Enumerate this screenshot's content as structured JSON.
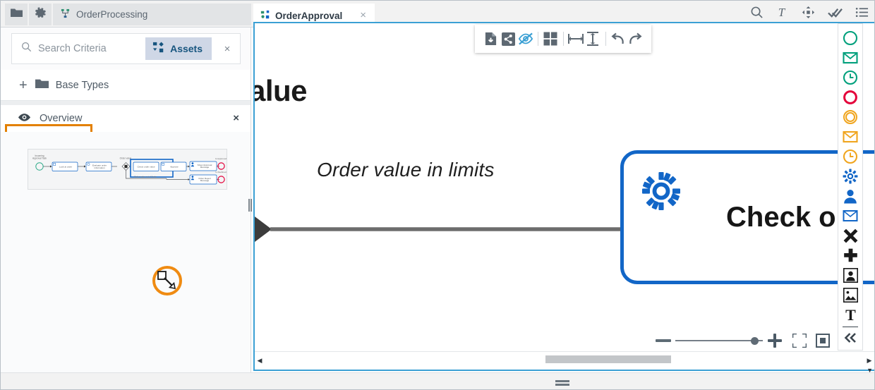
{
  "window": {
    "title": "OrderApproval"
  },
  "topbar": {
    "buttons": [
      {
        "name": "folder-icon",
        "label": ""
      },
      {
        "name": "gear-icon",
        "label": ""
      }
    ],
    "process_tab": {
      "label": "OrderProcessing",
      "icon": "process-diagram-icon"
    },
    "active_tab": {
      "label": "OrderApproval",
      "icon": "bpmn-diagram-icon",
      "close_label": "×"
    },
    "right_icons": [
      {
        "name": "search-icon"
      },
      {
        "name": "text-format-icon"
      },
      {
        "name": "move-icon"
      },
      {
        "name": "double-check-icon"
      },
      {
        "name": "list-icon"
      }
    ]
  },
  "sidebar": {
    "search": {
      "placeholder": "Search Criteria",
      "icon": "search-icon",
      "chip_label": "Assets",
      "chip_icon": "assets-icon",
      "clear_label": "×"
    },
    "base_types": {
      "add_label": "+",
      "label": "Base Types",
      "icon": "folder-icon"
    },
    "overview": {
      "label": "Overview",
      "icon": "eye-icon",
      "close_label": "×",
      "highlighted": true,
      "highlight_color": "#e38000"
    },
    "thumbnail": {
      "name": "overview-thumbnail",
      "nodes": [
        {
          "label": "Incoming\\nApproval Task",
          "type": "start-event"
        },
        {
          "label": "Look at order",
          "type": "task"
        },
        {
          "label": "Evaluate order\\ninformation",
          "type": "task"
        },
        {
          "label": "Order value",
          "type": "gateway"
        },
        {
          "label": "Check order value",
          "type": "task"
        },
        {
          "label": "Approve",
          "type": "task"
        },
        {
          "label": "Order Approved\\nMessage",
          "type": "task"
        },
        {
          "label": "Order Reject\\nMessage",
          "type": "task"
        },
        {
          "label": "Is Approved",
          "type": "end-event"
        },
        {
          "label": "Is Declined",
          "type": "end-event"
        }
      ],
      "viewport_box_color": "#1266c7",
      "cursor_highlight_color": "#ef8b12"
    }
  },
  "editor": {
    "border_color": "#3ba0d4",
    "float_toolbar": [
      {
        "name": "export-file-icon"
      },
      {
        "name": "share-icon"
      },
      {
        "name": "hide-eye-icon"
      },
      {
        "name": "grid-layout-icon"
      },
      {
        "name": "horizontal-spacing-icon"
      },
      {
        "name": "vertical-spacing-icon"
      },
      {
        "name": "undo-icon"
      },
      {
        "name": "redo-icon"
      }
    ],
    "canvas": {
      "clipped_title": "alue",
      "flow_label": "Order value in limits",
      "task": {
        "label": "Check ou",
        "icon": "gear-icon",
        "border_color": "#1266c7"
      }
    },
    "zoom_controls": {
      "zoom_out_label": "−",
      "zoom_in_label": "+",
      "slider_value": 92,
      "fit_icon": "fit-to-screen-icon",
      "actual_size_icon": "actual-size-icon"
    },
    "scrollbar": {
      "left_arrow": "◀",
      "right_arrow": "▶"
    }
  },
  "palette": {
    "items": [
      {
        "name": "start-event-none",
        "color": "#00a07c",
        "shape": "circle"
      },
      {
        "name": "start-event-message",
        "color": "#00a07c",
        "shape": "envelope"
      },
      {
        "name": "start-event-timer",
        "color": "#00a07c",
        "shape": "clock"
      },
      {
        "name": "end-event-none",
        "color": "#e4003a",
        "shape": "circle-thick"
      },
      {
        "name": "intermediate-event-none",
        "color": "#f0a51e",
        "shape": "double-circle"
      },
      {
        "name": "intermediate-event-message",
        "color": "#f0a51e",
        "shape": "envelope"
      },
      {
        "name": "intermediate-event-timer",
        "color": "#f0a51e",
        "shape": "clock"
      },
      {
        "name": "service-task",
        "color": "#1266c7",
        "shape": "gear"
      },
      {
        "name": "user-task",
        "color": "#1266c7",
        "shape": "person"
      },
      {
        "name": "message-task",
        "color": "#1266c7",
        "shape": "envelope-box"
      },
      {
        "name": "exclusive-gateway",
        "color": "#1a1a1a",
        "shape": "x-cross"
      },
      {
        "name": "parallel-gateway",
        "color": "#1a1a1a",
        "shape": "plus-cross"
      },
      {
        "name": "pool-participant",
        "color": "#1a1a1a",
        "shape": "person-frame"
      },
      {
        "name": "image-annotation",
        "color": "#1a1a1a",
        "shape": "image-frame"
      },
      {
        "name": "text-annotation",
        "color": "#1a1a1a",
        "shape": "text-t"
      },
      {
        "name": "collapse-palette",
        "color": "#3b454e",
        "shape": "double-chevron-left"
      }
    ]
  }
}
